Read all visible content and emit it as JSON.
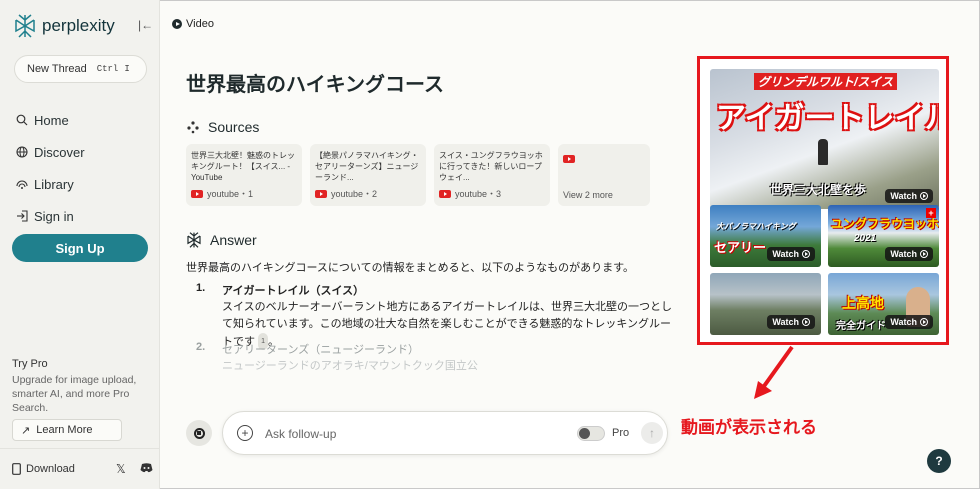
{
  "app": {
    "name": "perplexity"
  },
  "sidebar": {
    "new_thread": "New Thread",
    "shortcut_keys": [
      "Ctrl",
      "I"
    ],
    "nav": [
      {
        "label": "Home",
        "icon": "search-icon"
      },
      {
        "label": "Discover",
        "icon": "globe-icon"
      },
      {
        "label": "Library",
        "icon": "library-icon"
      },
      {
        "label": "Sign in",
        "icon": "sign-in-icon"
      }
    ],
    "signup": "Sign Up",
    "try_pro_title": "Try Pro",
    "try_pro_desc": "Upgrade for image upload, smarter AI, and more Pro Search.",
    "learn_more": "Learn More",
    "download": "Download"
  },
  "header": {
    "tab_label": "Video"
  },
  "main": {
    "title": "世界最高のハイキングコース",
    "sources_heading": "Sources",
    "sources": [
      {
        "text": "世界三大北壁！魅惑のトレッキングルート！【スイス... - YouTube",
        "meta": "youtube・1"
      },
      {
        "text": "【絶景パノラマハイキング・セアリーターンズ】ニュージーランド...",
        "meta": "youtube・2"
      },
      {
        "text": "スイス・ユングフラウヨッホに行ってきた！新しいロープウェイ...",
        "meta": "youtube・3"
      }
    ],
    "view_more": "View 2 more",
    "answer_heading": "Answer",
    "answer_intro": "世界最高のハイキングコースについての情報をまとめると、以下のようなものがあります。",
    "answers": [
      {
        "num": "1.",
        "title": "アイガートレイル（スイス）",
        "desc": "スイスのベルナーオーバーラント地方にあるアイガートレイルは、世界三大北壁の一つとして知られています。この地域の壮大な自然を楽しむことができる魅惑的なトレッキングルートです",
        "cite": "1",
        "cite_suffix": "。"
      },
      {
        "num": "2.",
        "title": "セアリーターンズ（ニュージーランド）",
        "desc": "ニュージーランドのアオラキ/マウントクック国立公"
      }
    ]
  },
  "followup": {
    "placeholder": "Ask follow-up",
    "pro_label": "Pro"
  },
  "videos": {
    "main": {
      "banner": "グリンデルワルト/スイス",
      "title": "アイガートレイル",
      "subtitle": "世界三大北壁を歩",
      "watch": "Watch"
    },
    "v2": {
      "caption": "大パノラマハイキング",
      "title": "セアリー",
      "watch": "Watch"
    },
    "v3": {
      "title": "ユングフラウヨッホ",
      "year": "2021",
      "watch": "Watch"
    },
    "v4": {
      "watch": "Watch"
    },
    "v5": {
      "title": "上高地",
      "subtitle": "完全ガイド",
      "watch": "Watch"
    }
  },
  "annotation": {
    "text": "動画が表示される",
    "color": "#e6181e"
  },
  "help": "?",
  "colors": {
    "accent": "#20808d",
    "highlight": "#e6181e",
    "youtube": "#e12424"
  }
}
